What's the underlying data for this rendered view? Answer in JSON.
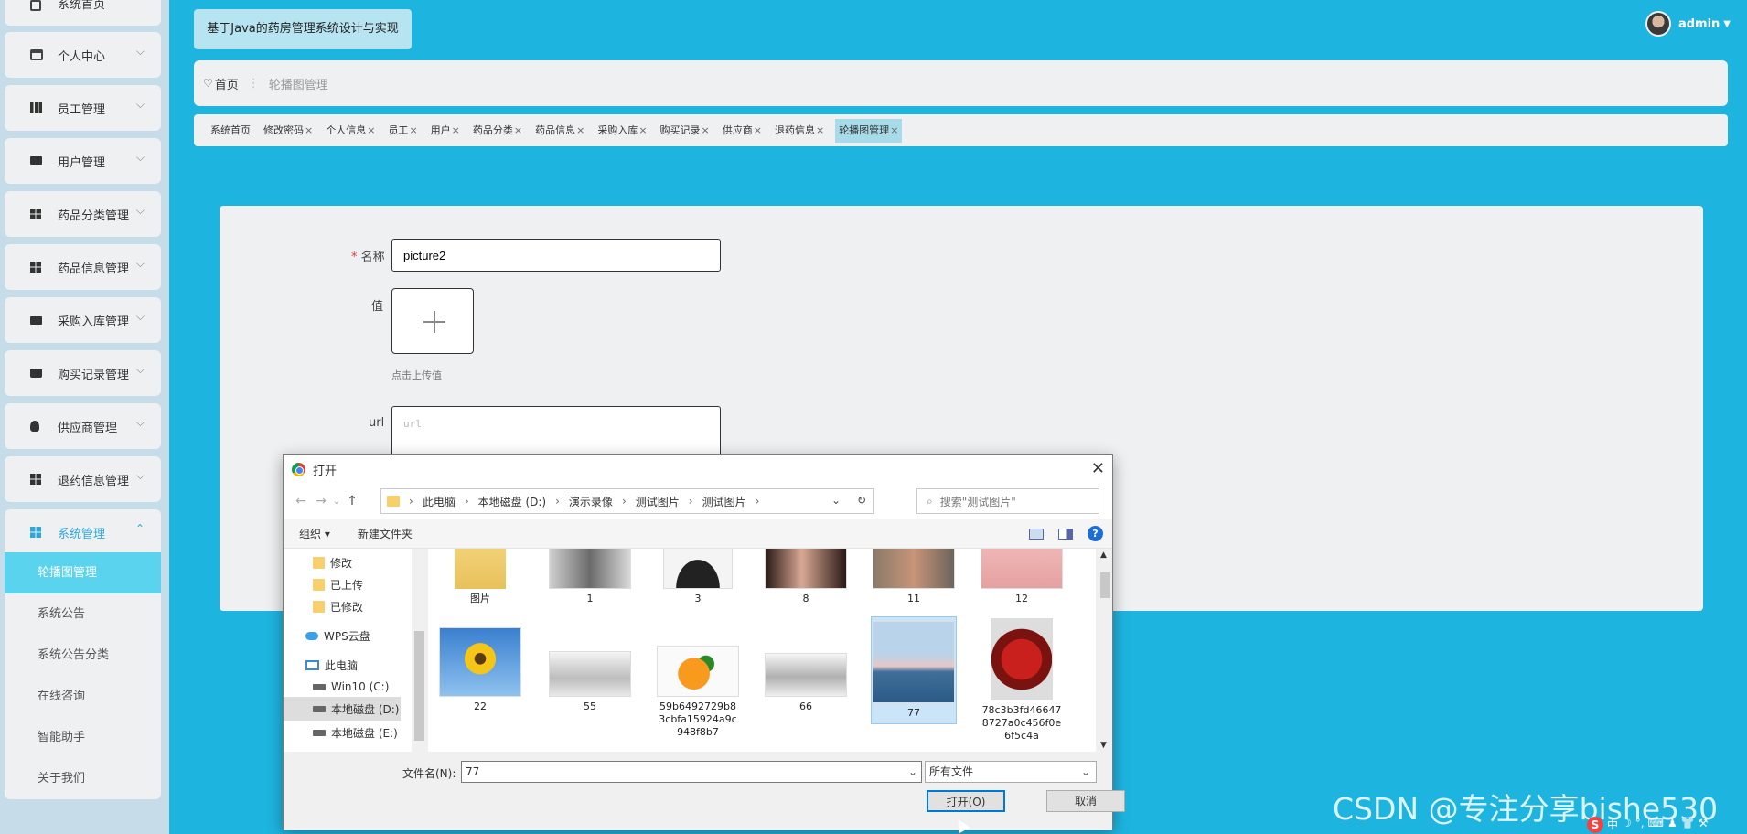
{
  "sidebar": {
    "items": [
      {
        "label": "系统首页",
        "icon": "home-icon"
      },
      {
        "label": "个人中心",
        "icon": "calendar-icon"
      },
      {
        "label": "员工管理",
        "icon": "bars-icon"
      },
      {
        "label": "用户管理",
        "icon": "monitor-icon"
      },
      {
        "label": "药品分类管理",
        "icon": "grid-icon"
      },
      {
        "label": "药品信息管理",
        "icon": "grid-icon"
      },
      {
        "label": "采购入库管理",
        "icon": "briefcase-icon"
      },
      {
        "label": "购买记录管理",
        "icon": "cart-icon"
      },
      {
        "label": "供应商管理",
        "icon": "bulb-icon"
      },
      {
        "label": "退药信息管理",
        "icon": "grid-icon"
      },
      {
        "label": "系统管理",
        "icon": "grid-icon"
      }
    ],
    "sub_items": [
      "轮播图管理",
      "系统公告",
      "系统公告分类",
      "在线咨询",
      "智能助手",
      "关于我们"
    ]
  },
  "header": {
    "system_title": "基于Java的药房管理系统设计与实现",
    "user": "admin"
  },
  "breadcrumb": {
    "home": "首页",
    "current": "轮播图管理"
  },
  "tabs": [
    "系统首页",
    "修改密码",
    "个人信息",
    "员工",
    "用户",
    "药品分类",
    "药品信息",
    "采购入库",
    "购买记录",
    "供应商",
    "退药信息",
    "轮播图管理"
  ],
  "form": {
    "name_label": "名称",
    "name_value": "picture2",
    "value_label": "值",
    "upload_hint": "点击上传值",
    "url_label": "url",
    "url_placeholder": "url"
  },
  "dialog": {
    "title": "打开",
    "path": [
      "此电脑",
      "本地磁盘 (D:)",
      "演示录像",
      "测试图片",
      "测试图片"
    ],
    "search_placeholder": "搜索\"测试图片\"",
    "organize": "组织 ▾",
    "new_folder": "新建文件夹",
    "nav_items": [
      {
        "label": "修改",
        "type": "folder"
      },
      {
        "label": "已上传",
        "type": "folder"
      },
      {
        "label": "已修改",
        "type": "folder"
      },
      {
        "label": "WPS云盘",
        "type": "cloud"
      },
      {
        "label": "此电脑",
        "type": "pc"
      },
      {
        "label": "Win10 (C:)",
        "type": "drive"
      },
      {
        "label": "本地磁盘 (D:)",
        "type": "drive"
      },
      {
        "label": "本地磁盘 (E:)",
        "type": "drive"
      }
    ],
    "files_row1": [
      "图片",
      "1",
      "3",
      "8",
      "11",
      "12"
    ],
    "files_row2": [
      "22",
      "55",
      "59b6492729b83cbfa15924a9c948f8b7",
      "66",
      "77",
      "78c3b3fd466478727a0c456f0e6f5c4a"
    ],
    "file_name_label": "文件名(N):",
    "file_name_value": "77",
    "file_type": "所有文件",
    "open_button": "打开(O)",
    "cancel_button": "取消"
  },
  "watermark": "CSDN @专注分享bishe530",
  "ime": [
    "S",
    "中",
    "☽",
    "°,",
    "⌨",
    "♟",
    "👕",
    "⚒"
  ]
}
